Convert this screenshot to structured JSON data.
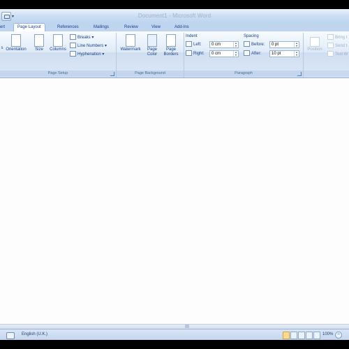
{
  "window": {
    "title": "Document1 - Microsoft Word"
  },
  "qat": {
    "dropdown_icon": "dropdown-arrow"
  },
  "tabs": [
    {
      "label": "ert",
      "active": false
    },
    {
      "label": "Page Layout",
      "active": true
    },
    {
      "label": "References",
      "active": false
    },
    {
      "label": "Mailings",
      "active": false
    },
    {
      "label": "Review",
      "active": false
    },
    {
      "label": "View",
      "active": false
    },
    {
      "label": "Add-Ins",
      "active": false
    }
  ],
  "page_setup": {
    "label": "Page Setup",
    "margins_partial": "s",
    "orientation": "Orientation",
    "size": "Size",
    "columns": "Columns",
    "breaks": "Breaks",
    "line_numbers": "Line Numbers",
    "hyphenation": "Hyphenation"
  },
  "page_background": {
    "label": "Page Background",
    "watermark": "Watermark",
    "page_color_1": "Page",
    "page_color_2": "Color",
    "page_borders_1": "Page",
    "page_borders_2": "Borders"
  },
  "paragraph": {
    "label": "Paragraph",
    "indent_label": "Indent",
    "left_label": "Left:",
    "left_value": "0 cm",
    "right_label": "Right:",
    "right_value": "0 cm",
    "spacing_label": "Spacing",
    "before_label": "Before:",
    "before_value": "0 pt",
    "after_label": "After:",
    "after_value": "10 pt"
  },
  "arrange": {
    "position": "Position",
    "bring_front": "Bring t",
    "send_back": "Send t",
    "text_wrap": "Text W"
  },
  "statusbar": {
    "language": "English (U.K.)",
    "zoom": "100%",
    "zoom_minus": "−"
  }
}
